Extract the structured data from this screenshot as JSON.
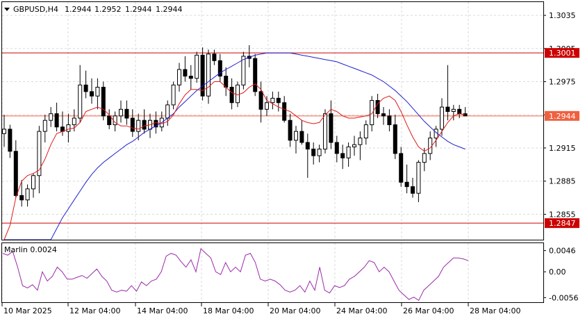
{
  "chart_data": [
    {
      "type": "candlestick",
      "symbol_header": "GBPUSD,H4",
      "ohlc_header": [
        "1.2944",
        "1.2952",
        "1.2944",
        "1.2944"
      ],
      "price_ticks": [
        "1.3035",
        "1.3005",
        "1.2975",
        "1.2945",
        "1.2915",
        "1.2885",
        "1.2855"
      ],
      "ylim": [
        1.2832,
        1.3047
      ],
      "x_ticks": [
        "10 Mar 2025",
        "12 Mar 04:00",
        "14 Mar 04:00",
        "18 Mar 04:00",
        "20 Mar 04:00",
        "24 Mar 04:00",
        "26 Mar 04:00",
        "28 Mar 04:00"
      ],
      "horizontal_levels": [
        {
          "price": 1.3001,
          "label": "1.3001",
          "color": "#cc0000"
        },
        {
          "price": 1.2847,
          "label": "1.2847",
          "color": "#cc0000"
        }
      ],
      "current_price": {
        "price": 1.2944,
        "label": "1.2944",
        "color": "#f06040"
      },
      "candles": [
        [
          1.2928,
          1.2945,
          1.2916,
          1.2932
        ],
        [
          1.2932,
          1.2936,
          1.2906,
          1.2912
        ],
        [
          1.2912,
          1.2922,
          1.287,
          1.2872
        ],
        [
          1.2872,
          1.2886,
          1.2862,
          1.2868
        ],
        [
          1.2868,
          1.2882,
          1.2862,
          1.2878
        ],
        [
          1.2878,
          1.2892,
          1.287,
          1.289
        ],
        [
          1.289,
          1.2935,
          1.2874,
          1.293
        ],
        [
          1.293,
          1.2945,
          1.292,
          1.294
        ],
        [
          1.294,
          1.2952,
          1.2934,
          1.2946
        ],
        [
          1.2946,
          1.2956,
          1.293,
          1.2934
        ],
        [
          1.2934,
          1.2948,
          1.2926,
          1.293
        ],
        [
          1.293,
          1.2946,
          1.292,
          1.2936
        ],
        [
          1.2936,
          1.295,
          1.293,
          1.2942
        ],
        [
          1.2942,
          1.299,
          1.2938,
          1.2972
        ],
        [
          1.2972,
          1.2985,
          1.296,
          1.2966
        ],
        [
          1.2966,
          1.2978,
          1.2955,
          1.2962
        ],
        [
          1.2962,
          1.2978,
          1.295,
          1.297
        ],
        [
          1.297,
          1.2975,
          1.294,
          1.2944
        ],
        [
          1.2944,
          1.295,
          1.2932,
          1.2936
        ],
        [
          1.2936,
          1.2948,
          1.293,
          1.2944
        ],
        [
          1.2944,
          1.2958,
          1.2938,
          1.295
        ],
        [
          1.295,
          1.2958,
          1.2936,
          1.2942
        ],
        [
          1.2942,
          1.295,
          1.2925,
          1.293
        ],
        [
          1.293,
          1.2946,
          1.2922,
          1.294
        ],
        [
          1.294,
          1.295,
          1.2928,
          1.2932
        ],
        [
          1.2932,
          1.2946,
          1.2924,
          1.294
        ],
        [
          1.294,
          1.2948,
          1.2928,
          1.2934
        ],
        [
          1.2934,
          1.2948,
          1.293,
          1.2942
        ],
        [
          1.2942,
          1.2958,
          1.2935,
          1.2954
        ],
        [
          1.2954,
          1.2975,
          1.295,
          1.2972
        ],
        [
          1.2972,
          1.2992,
          1.2966,
          1.2986
        ],
        [
          1.2986,
          1.2998,
          1.2975,
          1.298
        ],
        [
          1.298,
          1.299,
          1.2968,
          1.2978
        ],
        [
          1.2978,
          1.3002,
          1.2974,
          1.2999
        ],
        [
          1.2999,
          1.3006,
          1.2958,
          1.2962
        ],
        [
          1.2962,
          1.3004,
          1.2955,
          1.3
        ],
        [
          1.3,
          1.3004,
          1.299,
          1.2994
        ],
        [
          1.2994,
          1.3,
          1.2975,
          1.298
        ],
        [
          1.298,
          1.2988,
          1.2962,
          1.297
        ],
        [
          1.297,
          1.2978,
          1.295,
          1.2956
        ],
        [
          1.2956,
          1.2975,
          1.2952,
          1.2972
        ],
        [
          1.2972,
          1.3002,
          1.2968,
          1.2998
        ],
        [
          1.2998,
          1.3008,
          1.2988,
          1.2996
        ],
        [
          1.2996,
          1.3,
          1.2962,
          1.2966
        ],
        [
          1.2966,
          1.2975,
          1.2938,
          1.295
        ],
        [
          1.295,
          1.2962,
          1.2944,
          1.2956
        ],
        [
          1.2956,
          1.2966,
          1.295,
          1.296
        ],
        [
          1.296,
          1.2966,
          1.2948,
          1.2956
        ],
        [
          1.2956,
          1.2962,
          1.2938,
          1.294
        ],
        [
          1.294,
          1.2946,
          1.2916,
          1.2922
        ],
        [
          1.2922,
          1.2935,
          1.291,
          1.293
        ],
        [
          1.293,
          1.294,
          1.2918,
          1.292
        ],
        [
          1.292,
          1.2928,
          1.2888,
          1.2914
        ],
        [
          1.2914,
          1.292,
          1.29,
          1.2908
        ],
        [
          1.2908,
          1.2918,
          1.2902,
          1.2914
        ],
        [
          1.2914,
          1.295,
          1.291,
          1.2946
        ],
        [
          1.2946,
          1.2958,
          1.2914,
          1.292
        ],
        [
          1.292,
          1.2926,
          1.2902,
          1.291
        ],
        [
          1.291,
          1.2918,
          1.2896,
          1.2906
        ],
        [
          1.2906,
          1.292,
          1.2898,
          1.2916
        ],
        [
          1.2916,
          1.2926,
          1.2908,
          1.2918
        ],
        [
          1.2918,
          1.293,
          1.2904,
          1.2924
        ],
        [
          1.2924,
          1.294,
          1.2918,
          1.2936
        ],
        [
          1.2936,
          1.2962,
          1.293,
          1.2958
        ],
        [
          1.2958,
          1.2964,
          1.2942,
          1.2946
        ],
        [
          1.2946,
          1.2952,
          1.2936,
          1.2944
        ],
        [
          1.2944,
          1.295,
          1.293,
          1.2936
        ],
        [
          1.2936,
          1.2945,
          1.2905,
          1.291
        ],
        [
          1.291,
          1.2916,
          1.288,
          1.2884
        ],
        [
          1.2884,
          1.29,
          1.2874,
          1.288
        ],
        [
          1.288,
          1.2888,
          1.287,
          1.2874
        ],
        [
          1.2874,
          1.2904,
          1.2866,
          1.2902
        ],
        [
          1.2902,
          1.2915,
          1.2894,
          1.291
        ],
        [
          1.291,
          1.293,
          1.2904,
          1.2924
        ],
        [
          1.2924,
          1.2935,
          1.2916,
          1.2932
        ],
        [
          1.2932,
          1.296,
          1.2926,
          1.2952
        ],
        [
          1.2952,
          1.299,
          1.294,
          1.2948
        ],
        [
          1.2948,
          1.2954,
          1.294,
          1.295
        ],
        [
          1.295,
          1.2954,
          1.2942,
          1.2946
        ],
        [
          1.2946,
          1.2952,
          1.2944,
          1.2944
        ]
      ],
      "ma_fast": [
        1.281,
        1.2845,
        1.287,
        1.2885,
        1.289,
        1.2892,
        1.2895,
        1.2905,
        1.2918,
        1.2928,
        1.293,
        1.2932,
        1.2933,
        1.2938,
        1.2948,
        1.295,
        1.2952,
        1.295,
        1.2945,
        1.2938,
        1.2935,
        1.2935,
        1.2933,
        1.2932,
        1.2935,
        1.2936,
        1.2938,
        1.2937,
        1.2939,
        1.2945,
        1.2955,
        1.2963,
        1.2968,
        1.2968,
        1.2967,
        1.297,
        1.2975,
        1.2975,
        1.297,
        1.2965,
        1.2963,
        1.2965,
        1.297,
        1.2973,
        1.2968,
        1.2958,
        1.2955,
        1.2952,
        1.295,
        1.2948,
        1.2944,
        1.294,
        1.2938,
        1.2937,
        1.2938,
        1.2945,
        1.295,
        1.2948,
        1.2944,
        1.2942,
        1.2942,
        1.2943,
        1.2944,
        1.2946,
        1.2955,
        1.296,
        1.2962,
        1.2958,
        1.2948,
        1.2936,
        1.2925,
        1.2916,
        1.2912,
        1.2915,
        1.2922,
        1.293,
        1.2938,
        1.2944,
        1.2946,
        1.2945
      ],
      "ma_slow": [
        1.2752,
        1.2762,
        1.2772,
        1.2782,
        1.2792,
        1.2802,
        1.2812,
        1.2822,
        1.2832,
        1.2842,
        1.2852,
        1.286,
        1.2868,
        1.2876,
        1.2884,
        1.2891,
        1.2897,
        1.2902,
        1.2906,
        1.291,
        1.2914,
        1.2918,
        1.2921,
        1.2925,
        1.2929,
        1.2932,
        1.2935,
        1.2938,
        1.2942,
        1.2946,
        1.2952,
        1.2957,
        1.2962,
        1.2967,
        1.2971,
        1.2975,
        1.2979,
        1.2983,
        1.2986,
        1.2989,
        1.2992,
        1.2995,
        1.2997,
        1.2999,
        1.3,
        1.3001,
        1.3001,
        1.3001,
        1.3001,
        1.3001,
        1.3,
        1.2999,
        1.2998,
        1.2997,
        1.2996,
        1.2995,
        1.2994,
        1.2993,
        1.2991,
        1.2989,
        1.2987,
        1.2985,
        1.2983,
        1.2981,
        1.2978,
        1.2975,
        1.2971,
        1.2967,
        1.2962,
        1.2957,
        1.2951,
        1.2945,
        1.2939,
        1.2934,
        1.2929,
        1.2925,
        1.2921,
        1.2918,
        1.2916,
        1.2914
      ]
    },
    {
      "type": "line",
      "label": "Marlin 0.0024",
      "ticks": [
        "0.0046",
        "0.00",
        "-0.0056"
      ],
      "ylim": [
        -0.0066,
        0.0062
      ],
      "color": "#9a2aa8",
      "values": [
        0.004,
        0.0036,
        0.0044,
        0.001,
        -0.003,
        -0.0035,
        -0.0028,
        -0.004,
        0.0,
        -0.002,
        -0.001,
        0.001,
        0.0,
        -0.0016,
        -0.0016,
        -0.0012,
        -0.0008,
        -0.0014,
        -0.0004,
        0.0006,
        -0.001,
        -0.002,
        -0.004,
        -0.0044,
        -0.004,
        -0.0042,
        -0.003,
        -0.0042,
        -0.0022,
        -0.003,
        -0.002,
        -0.0016,
        0.0,
        0.0034,
        0.004,
        0.0036,
        0.0022,
        0.001,
        0.0026,
        0.0,
        0.005,
        0.004,
        0.003,
        0.0,
        -0.0006,
        0.002,
        0.0,
        0.001,
        0.0,
        0.0036,
        0.004,
        0.002,
        -0.0016,
        -0.002,
        -0.0016,
        -0.002,
        -0.0028,
        -0.004,
        -0.0044,
        -0.004,
        -0.003,
        -0.0044,
        -0.002,
        -0.004,
        0.001,
        -0.004,
        -0.0046,
        -0.003,
        -0.0034,
        -0.003,
        -0.0016,
        -0.001,
        0.0,
        0.001,
        0.0024,
        0.002,
        0.0,
        0.001,
        0.0,
        -0.002,
        -0.004,
        -0.005,
        -0.006,
        -0.0055,
        -0.0062,
        -0.004,
        -0.003,
        -0.002,
        -0.001,
        0.001,
        0.002,
        0.003,
        0.003,
        0.0028,
        0.0024
      ]
    }
  ]
}
